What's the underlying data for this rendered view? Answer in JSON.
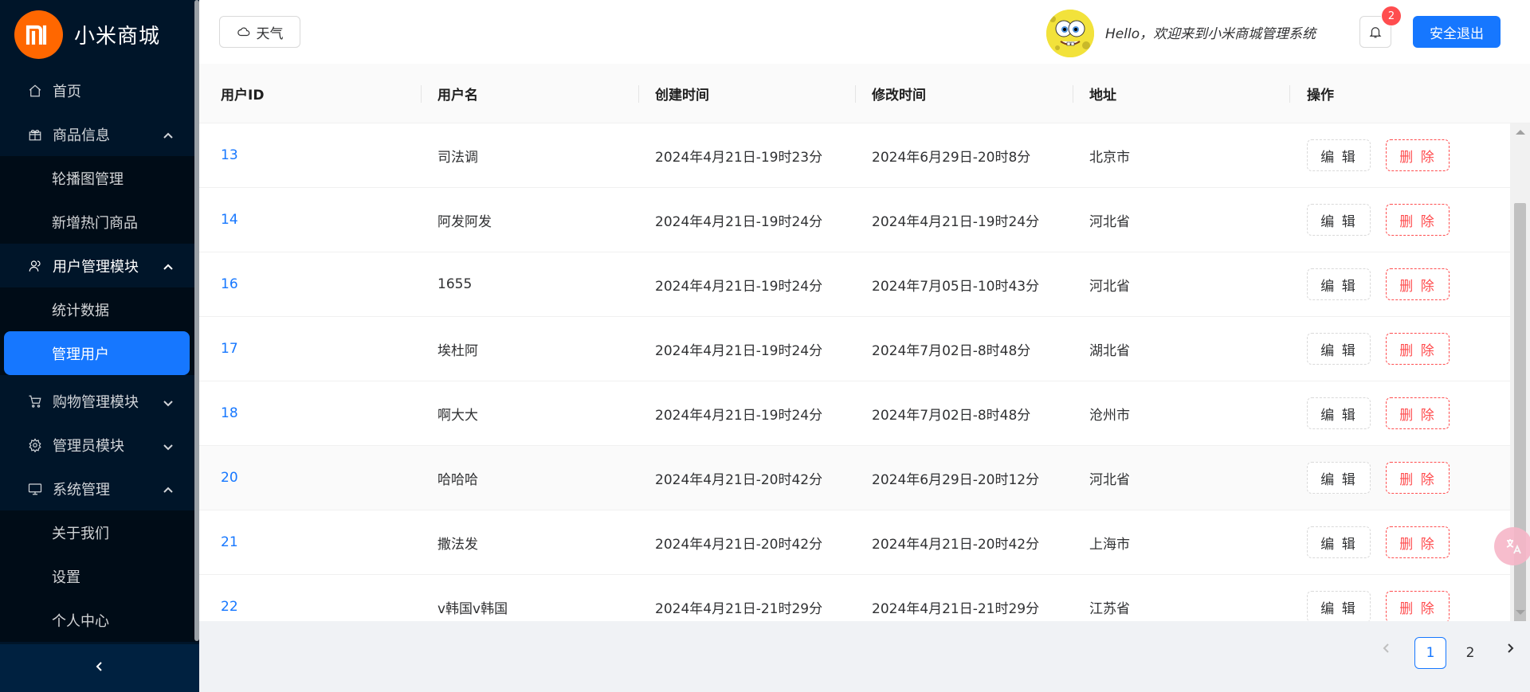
{
  "app": {
    "logo_mark": "mi",
    "title": "小米商城"
  },
  "sidebar": {
    "items": [
      {
        "label": "首页",
        "icon": "home-icon"
      },
      {
        "label": "商品信息",
        "icon": "gift-icon",
        "expanded": true,
        "children": [
          "轮播图管理",
          "新增热门商品"
        ]
      },
      {
        "label": "用户管理模块",
        "icon": "user-icon",
        "expanded": true,
        "children": [
          "统计数据",
          "管理用户"
        ],
        "selected_child": "管理用户"
      },
      {
        "label": "购物管理模块",
        "icon": "cart-icon",
        "expanded": false
      },
      {
        "label": "管理员模块",
        "icon": "settings-icon",
        "expanded": false
      },
      {
        "label": "系统管理",
        "icon": "desktop-icon",
        "expanded": true,
        "children": [
          "关于我们",
          "设置",
          "个人中心"
        ]
      }
    ]
  },
  "header": {
    "weather_label": "天气",
    "greeting": "Hello，欢迎来到小米商城管理系统",
    "notification_count": "2",
    "logout_label": "安全退出"
  },
  "table": {
    "columns": [
      "用户ID",
      "用户名",
      "创建时间",
      "修改时间",
      "地址",
      "操作"
    ],
    "edit_label": "编 辑",
    "delete_label": "删 除",
    "rows": [
      {
        "id": "13",
        "name": "司法调",
        "created": "2024年4月21日-19时23分",
        "modified": "2024年6月29日-20时8分",
        "address": "北京市"
      },
      {
        "id": "14",
        "name": "阿发阿发",
        "created": "2024年4月21日-19时24分",
        "modified": "2024年4月21日-19时24分",
        "address": "河北省"
      },
      {
        "id": "16",
        "name": "1655",
        "created": "2024年4月21日-19时24分",
        "modified": "2024年7月05日-10时43分",
        "address": "河北省"
      },
      {
        "id": "17",
        "name": "埃杜阿",
        "created": "2024年4月21日-19时24分",
        "modified": "2024年7月02日-8时48分",
        "address": "湖北省"
      },
      {
        "id": "18",
        "name": "啊大大",
        "created": "2024年4月21日-19时24分",
        "modified": "2024年7月02日-8时48分",
        "address": "沧州市"
      },
      {
        "id": "20",
        "name": "哈哈哈",
        "created": "2024年4月21日-20时42分",
        "modified": "2024年6月29日-20时12分",
        "address": "河北省"
      },
      {
        "id": "21",
        "name": "撒法发",
        "created": "2024年4月21日-20时42分",
        "modified": "2024年4月21日-20时42分",
        "address": "上海市"
      },
      {
        "id": "22",
        "name": "v韩国v韩国",
        "created": "2024年4月21日-21时29分",
        "modified": "2024年4月21日-21时29分",
        "address": "江苏省"
      }
    ]
  },
  "pagination": {
    "pages": [
      "1",
      "2"
    ],
    "current": "1"
  },
  "colors": {
    "primary": "#1677ff",
    "danger": "#ff4d4f",
    "brand": "#ff6700",
    "sidebar_bg": "#001529"
  }
}
